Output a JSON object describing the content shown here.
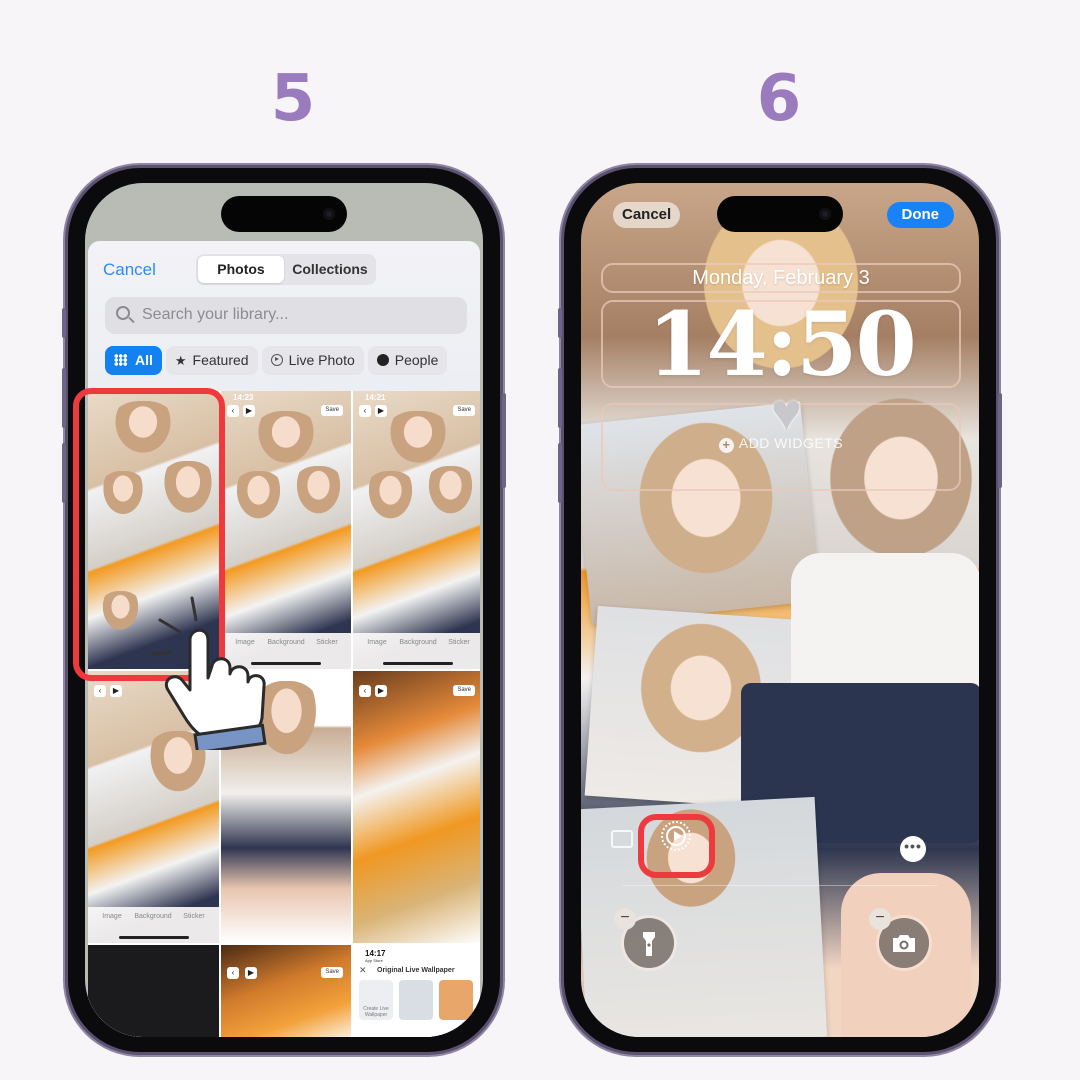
{
  "steps": {
    "left": "5",
    "right": "6"
  },
  "phone5": {
    "picker": {
      "cancel_label": "Cancel",
      "tabs": [
        {
          "label": "Photos",
          "selected": true
        },
        {
          "label": "Collections",
          "selected": false
        }
      ],
      "search_placeholder": "Search your library...",
      "filters": [
        {
          "label": "All",
          "icon": "grid-icon",
          "selected": true
        },
        {
          "label": "Featured",
          "icon": "star-icon",
          "selected": false
        },
        {
          "label": "Live Photo",
          "icon": "live-photo-icon",
          "selected": false
        },
        {
          "label": "People",
          "icon": "person-icon",
          "selected": false
        }
      ]
    },
    "thumbnails": [
      {
        "time": "",
        "save": ""
      },
      {
        "time": "14:23",
        "save": "Save"
      },
      {
        "time": "14:21",
        "save": "Save"
      }
    ],
    "thumb_bar": {
      "image": "Image",
      "background": "Background",
      "sticker": "Sticker"
    },
    "live_wallpaper_panel": {
      "time": "14:17",
      "back_label": "App Store",
      "title": "Original Live Wallpaper",
      "create_label": "Create Live Wallpaper"
    },
    "highlight_color": "#ee3a3e"
  },
  "phone6": {
    "cancel_label": "Cancel",
    "done_label": "Done",
    "date": "Monday, February 3",
    "time": "14:50",
    "add_widgets_label": "ADD WIDGETS",
    "accent_color": "#1a82f7",
    "highlight_color": "#ee3a3e"
  }
}
